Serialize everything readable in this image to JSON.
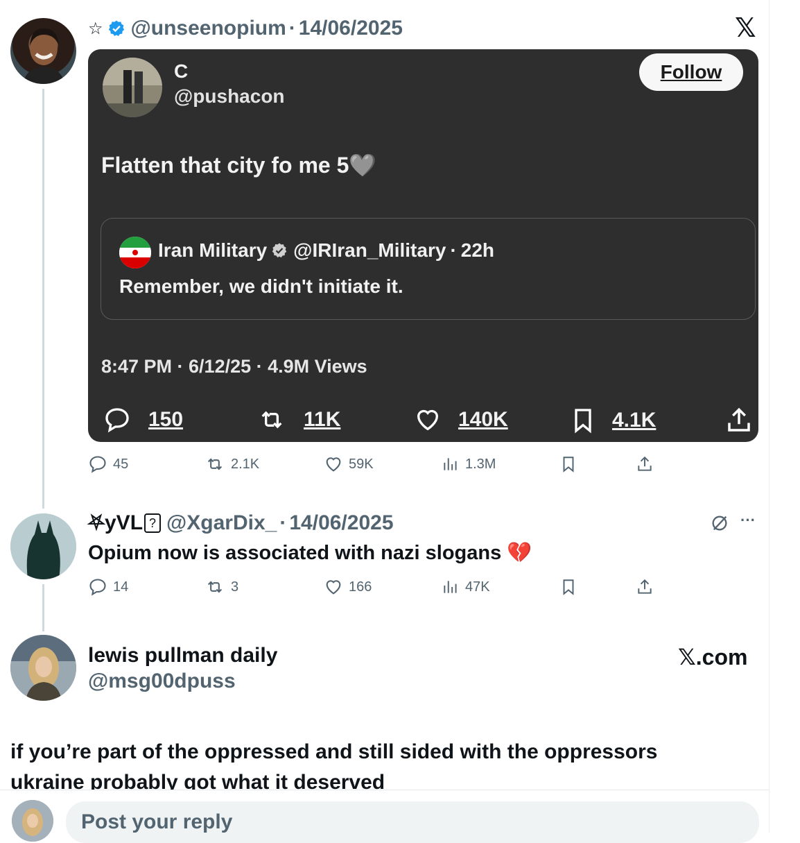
{
  "main_tweet": {
    "star": "☆",
    "handle": "@unseenopium",
    "date": "14/06/2025",
    "close_glyph": "𝕏",
    "stats": {
      "replies": "45",
      "reposts": "2.1K",
      "likes": "59K",
      "views": "1.3M"
    }
  },
  "embedded": {
    "name": "C",
    "handle": "@pushacon",
    "follow_label": "Follow",
    "text": "Flatten that city fo me 5🩶",
    "quote": {
      "name": "Iran Military",
      "handle": "@IRIran_Military",
      "time": "22h",
      "text": "Remember, we didn't initiate it."
    },
    "meta": "8:47 PM · 6/12/25 · 4.9M Views",
    "stats": {
      "replies": "150",
      "reposts": "11K",
      "likes": "140K",
      "bookmarks": "4.1K"
    }
  },
  "reply": {
    "name": "⛧yVL",
    "name_box": "?",
    "handle": "@XgarDix_",
    "date": "14/06/2025",
    "text": "Opium now is associated with nazi slogans 💔",
    "more": "···",
    "stats": {
      "replies": "14",
      "reposts": "3",
      "likes": "166",
      "views": "47K"
    }
  },
  "third": {
    "name": "lewis pullman daily",
    "handle": "@msg00dpuss",
    "site": "𝕏.com",
    "text_line1": "if you’re part of the oppressed and still sided with the oppressors",
    "text_line2": "ukraine probably got what it deserved"
  },
  "reply_box": {
    "placeholder": "Post your reply"
  },
  "colors": {
    "verified_blue": "#1d9bf0",
    "card_bg": "#2e2e2f",
    "muted": "#536471"
  }
}
